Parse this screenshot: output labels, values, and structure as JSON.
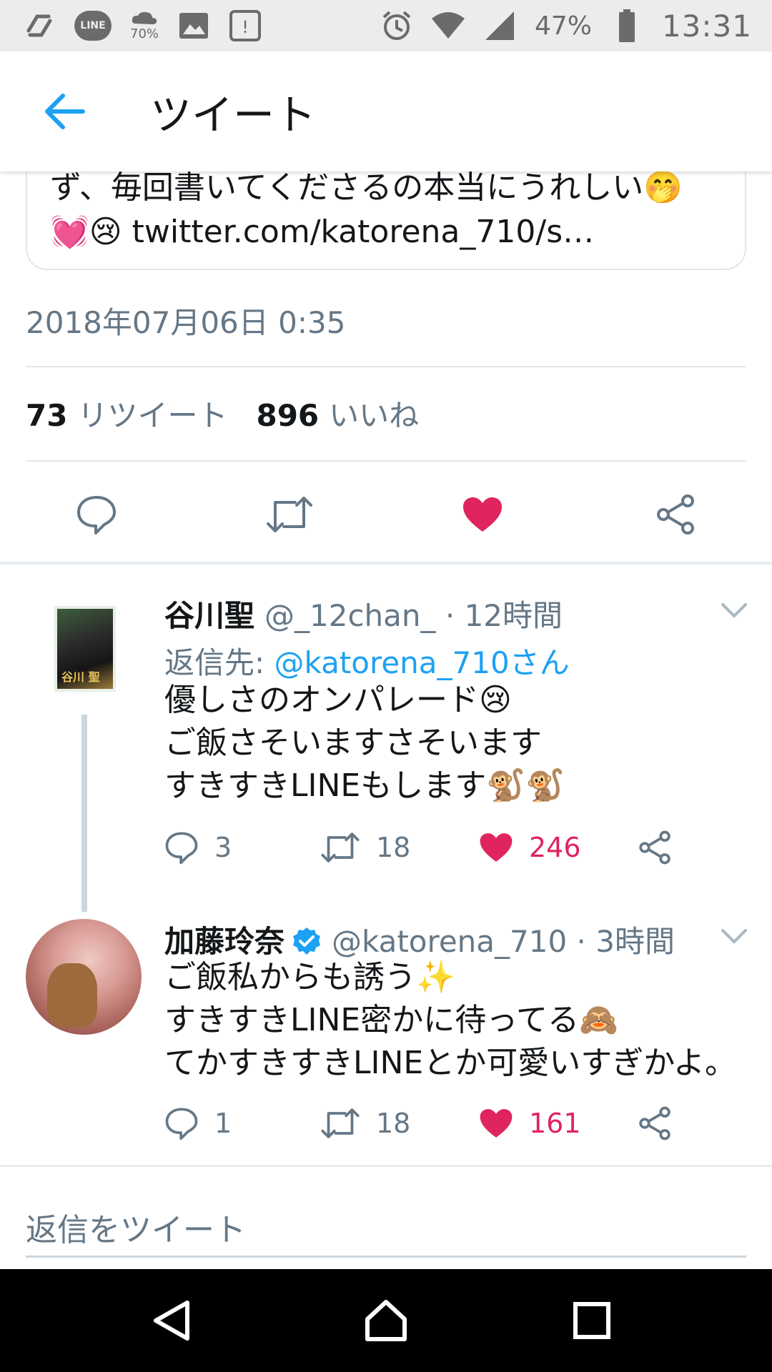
{
  "statusbar": {
    "line_badge": "LINE",
    "weather_temp": "70%",
    "battery_percent": "47%",
    "time": "13:31"
  },
  "appbar": {
    "title": "ツイート"
  },
  "quoted_tweet": {
    "line1": "ず、毎回書いてくださるの本当にうれしい🤭",
    "line2": "💓😢 twitter.com/katorena_710/s…"
  },
  "tweet": {
    "timestamp": "2018年07月06日 0:35",
    "retweet_count": "73",
    "retweet_label": "リツイート",
    "like_count": "896",
    "like_label": "いいね"
  },
  "replies": [
    {
      "name": "谷川聖",
      "handle_time": "@_12chan_ · 12時間",
      "avatar_tag": "谷川 聖",
      "reply_to_label": "返信先: ",
      "reply_to_mention": "@katorena_710さん",
      "body": [
        "優しさのオンパレード😢",
        "ご飯さそいますさそいます",
        "すきすきLINEもします🐒🐒"
      ],
      "reply_count": "3",
      "retweet_count": "18",
      "like_count": "246"
    },
    {
      "name": "加藤玲奈",
      "handle_time": "@katorena_710 · 3時間",
      "verified": true,
      "body": [
        "ご飯私からも誘う✨",
        "すきすきLINE密かに待ってる🙈",
        "てかすきすきLINEとか可愛いすぎかよ。"
      ],
      "reply_count": "1",
      "retweet_count": "18",
      "like_count": "161"
    }
  ],
  "reply_box": {
    "placeholder": "返信をツイート"
  },
  "colors": {
    "accent": "#1da1f2",
    "like": "#e0245e",
    "secondary_text": "#657786"
  }
}
